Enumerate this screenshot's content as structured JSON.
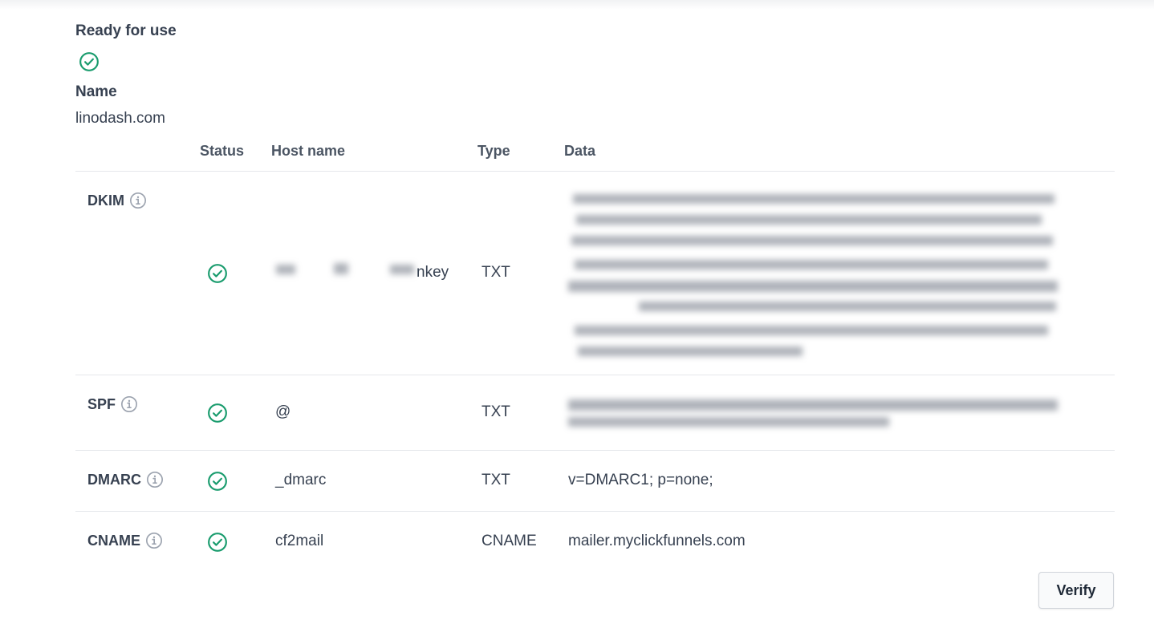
{
  "header": {
    "ready_label": "Ready for use",
    "name_label": "Name",
    "name_value": "linodash.com"
  },
  "table": {
    "columns": {
      "status": "Status",
      "host": "Host name",
      "type": "Type",
      "data": "Data"
    },
    "rows": [
      {
        "name": "DKIM",
        "host": "nkey",
        "type": "TXT",
        "data": ""
      },
      {
        "name": "SPF",
        "host": "@",
        "type": "TXT",
        "data": ""
      },
      {
        "name": "DMARC",
        "host": "_dmarc",
        "type": "TXT",
        "data": "v=DMARC1; p=none;"
      },
      {
        "name": "CNAME",
        "host": "cf2mail",
        "type": "CNAME",
        "data": "mailer.myclickfunnels.com"
      }
    ]
  },
  "actions": {
    "verify_label": "Verify"
  },
  "colors": {
    "success": "#1a9c6e",
    "info": "#9ca3af",
    "border": "#e5e7eb"
  },
  "icons": {
    "status": "check-circle-icon",
    "info": "info-icon"
  }
}
